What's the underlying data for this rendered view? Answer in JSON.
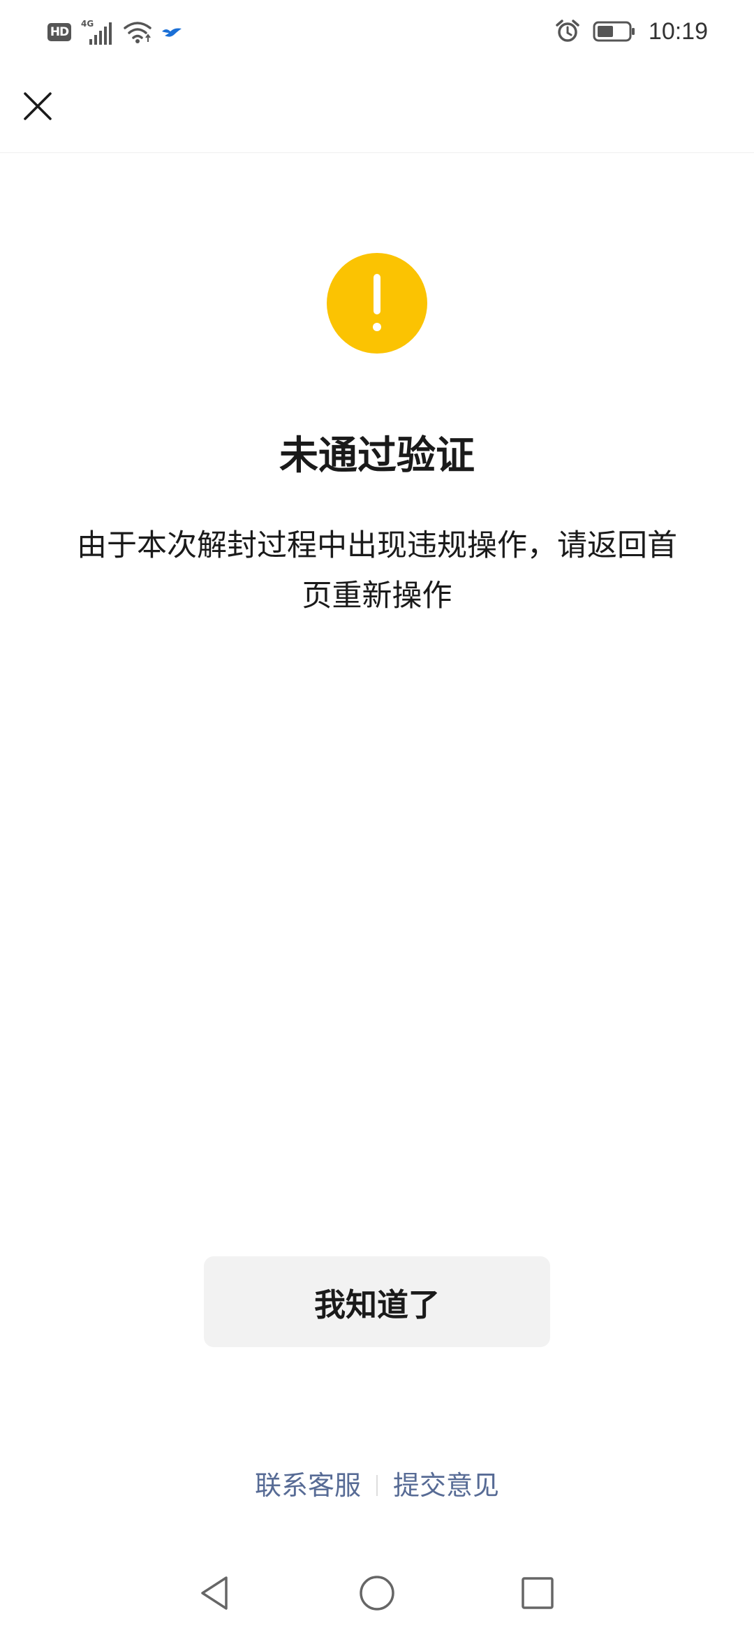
{
  "status_bar": {
    "hd": "HD",
    "network": "4G",
    "time": "10:19",
    "icons": [
      "hd-icon",
      "signal-icon",
      "wifi-icon",
      "bird-icon",
      "alarm-icon",
      "battery-icon"
    ]
  },
  "header": {
    "close_icon": "close-icon"
  },
  "dialog": {
    "icon": "warning-icon",
    "icon_color": "#fbc302",
    "title": "未通过验证",
    "description": "由于本次解封过程中出现违规操作，请返回首页重新操作"
  },
  "ok_button": {
    "label": "我知道了"
  },
  "footer": {
    "links": [
      "联系客服",
      "提交意见"
    ],
    "link_color": "#576b95"
  },
  "nav_bar": {
    "icons": [
      "back-icon",
      "home-icon",
      "recents-icon"
    ]
  }
}
